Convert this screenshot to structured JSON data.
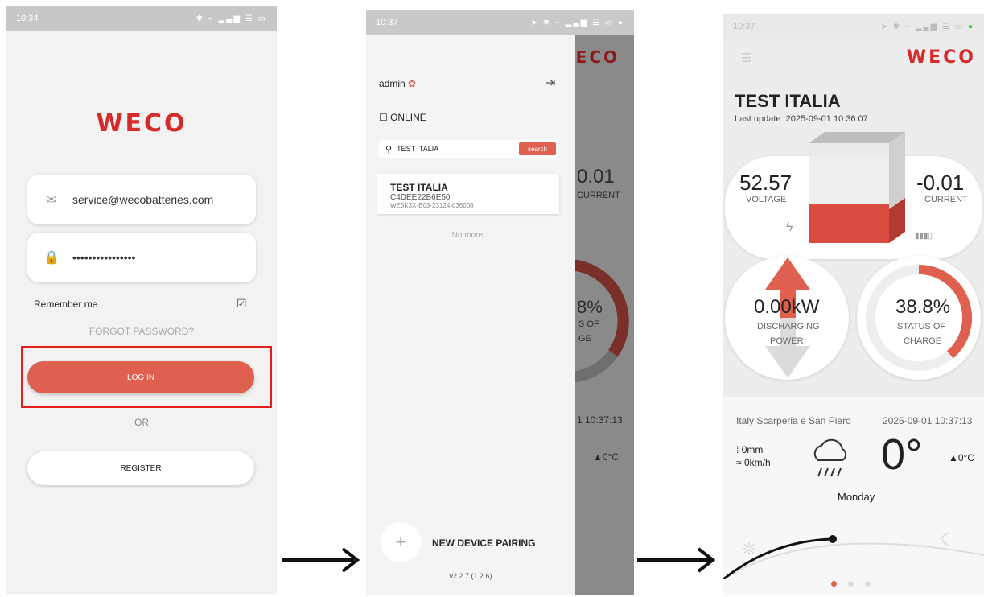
{
  "screen1": {
    "time": "10:34",
    "logo": "WECO",
    "email_value": "service@wecobatteries.com",
    "password_value": "••••••••••••••••",
    "remember_label": "Remember me",
    "forgot_label": "FORGOT PASSWORD?",
    "login_label": "LOG IN",
    "or_label": "OR",
    "register_label": "REGISTER"
  },
  "screen2": {
    "time": "10:37",
    "user": "admin",
    "online_label": "ONLINE",
    "search_value": "TEST ITALIA",
    "search_button": "search",
    "device_name": "TEST ITALIA",
    "device_id": "C4DEE22B6E50",
    "device_serial": "WE5K3X-B03-23124-036008",
    "no_more": "No more...",
    "new_device_label": "NEW DEVICE PAIRING",
    "version": "v2.2.7 (1.2.6)",
    "bg_current_value": "0.01",
    "bg_current_label": "CURRENT",
    "bg_soc_value": "8%",
    "bg_soc_label_1": "S OF",
    "bg_soc_label_2": "GE",
    "bg_time": "1 10:37:13",
    "bg_temp": "▲0°C",
    "logo": "WECO"
  },
  "screen3": {
    "time": "10:37",
    "logo": "WECO",
    "device_name": "TEST ITALIA",
    "last_update_label": "Last update:",
    "last_update_value": "2025-09-01 10:36:07",
    "voltage_value": "52.57",
    "voltage_label": "VOLTAGE",
    "current_value": "-0.01",
    "current_label": "CURRENT",
    "power_value": "0.00kW",
    "power_label_1": "DISCHARGING",
    "power_label_2": "POWER",
    "soc_value": "38.8%",
    "soc_percent": 38.8,
    "soc_label_1": "STATUS OF",
    "soc_label_2": "CHARGE",
    "location": "Italy Scarperia e San Piero",
    "weather_time": "2025-09-01 10:37:13",
    "rain": "0mm",
    "wind": "0km/h",
    "temperature": "0°",
    "temp_small": "▲0°C",
    "day": "Monday"
  },
  "colors": {
    "accent": "#e0604f",
    "logo_red": "#d62b2b",
    "highlight": "#e51c1c"
  }
}
